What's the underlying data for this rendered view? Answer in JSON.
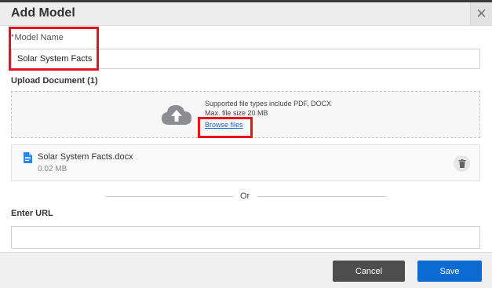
{
  "dialog": {
    "title": "Add Model",
    "close_glyph": "✕"
  },
  "model_name": {
    "required_mark": "*",
    "label": "Model Name",
    "value": "Solar System Facts"
  },
  "upload": {
    "label": "Upload Document (1)",
    "supported_text": "Supported file types include PDF, DOCX",
    "max_size_text": "Max. file size 20 MB",
    "browse_label": "Browse files"
  },
  "file": {
    "name": "Solar System Facts.docx",
    "size": "0.02 MB"
  },
  "separator": {
    "text": "Or"
  },
  "url": {
    "label": "Enter URL",
    "value": ""
  },
  "footer": {
    "cancel_label": "Cancel",
    "save_label": "Save"
  },
  "colors": {
    "primary": "#0b6bd3",
    "cancel": "#4d4d4d",
    "highlight": "#e8121f",
    "link": "#1b66c9"
  },
  "icons": {
    "upload": "cloud-upload-icon",
    "file": "docx-file-icon",
    "delete": "trash-icon",
    "close": "close-icon"
  }
}
